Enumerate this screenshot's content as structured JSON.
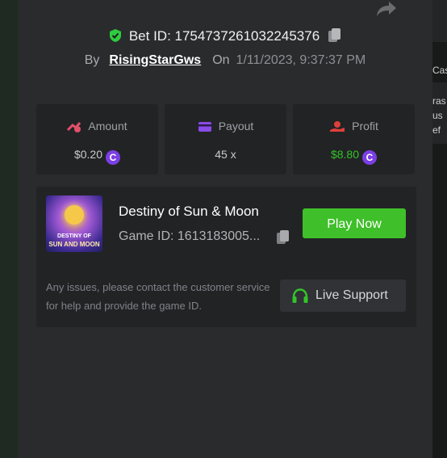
{
  "bet": {
    "label": "Bet ID: 1754737261032245376",
    "by_label": "By",
    "username": "RisingStarGws",
    "on_label": "On",
    "date": "1/11/2023, 9:37:37 PM"
  },
  "stats": {
    "amount": {
      "label": "Amount",
      "value": "$0.20"
    },
    "payout": {
      "label": "Payout",
      "value": "45 x"
    },
    "profit": {
      "label": "Profit",
      "value": "$8.80"
    }
  },
  "coin_symbol": "C",
  "game": {
    "title": "Destiny of Sun & Moon",
    "id_text": "Game ID: 1613183005...",
    "thumb_line1": "DESTINY OF",
    "thumb_line2": "SUN AND MOON",
    "play_label": "Play Now"
  },
  "support": {
    "text": "Any issues, please contact the customer service for help and provide the game ID.",
    "button_label": "Live Support"
  },
  "background_edge": {
    "line1": "Cas",
    "line2": "ras",
    "line3": "us",
    "line4": "ef"
  },
  "colors": {
    "accent_green": "#3fbf2a",
    "profit_green": "#34c32a",
    "coin_purple": "#7b3fe4",
    "amount_icon": "#e0506a",
    "payout_icon": "#8a4be8",
    "profit_icon": "#e0403a"
  }
}
